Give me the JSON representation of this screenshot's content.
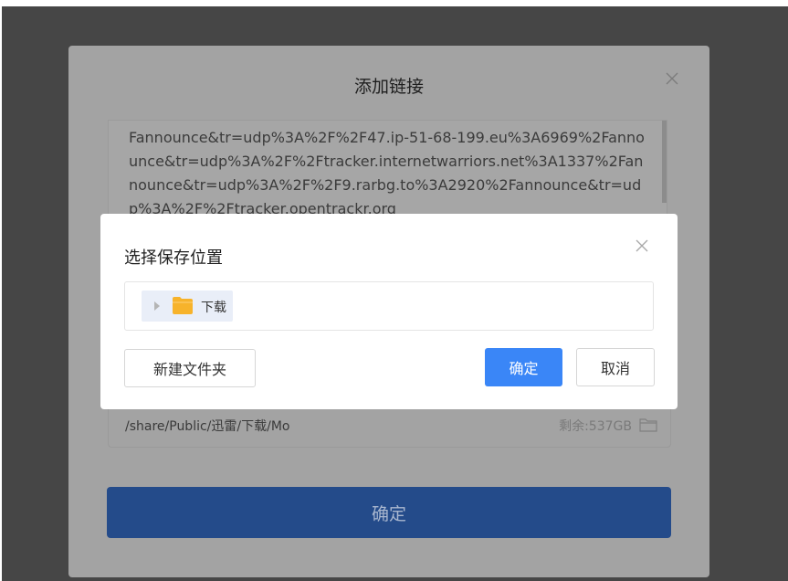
{
  "add_link_dialog": {
    "title": "添加链接",
    "link_text": "Fannounce&tr=udp%3A%2F%2F47.ip-51-68-199.eu%3A6969%2Fannounce&tr=udp%3A%2F%2Ftracker.internetwarriors.net%3A1337%2Fannounce&tr=udp%3A%2F%2F9.rarbg.to%3A2920%2Fannounce&tr=udp%3A%2F%2Ftracker.opentrackr.org",
    "save_path": "/share/Public/迅雷/下载/Mo",
    "free_space": "剩余:537GB",
    "confirm_label": "确定"
  },
  "save_location_dialog": {
    "title": "选择保存位置",
    "tree": [
      {
        "label": "下载",
        "icon": "folder-icon"
      }
    ],
    "new_folder_label": "新建文件夹",
    "confirm_label": "确定",
    "cancel_label": "取消"
  },
  "colors": {
    "primary": "#3a86f7",
    "folder": "#f7b32b",
    "overlay": "#464646"
  }
}
